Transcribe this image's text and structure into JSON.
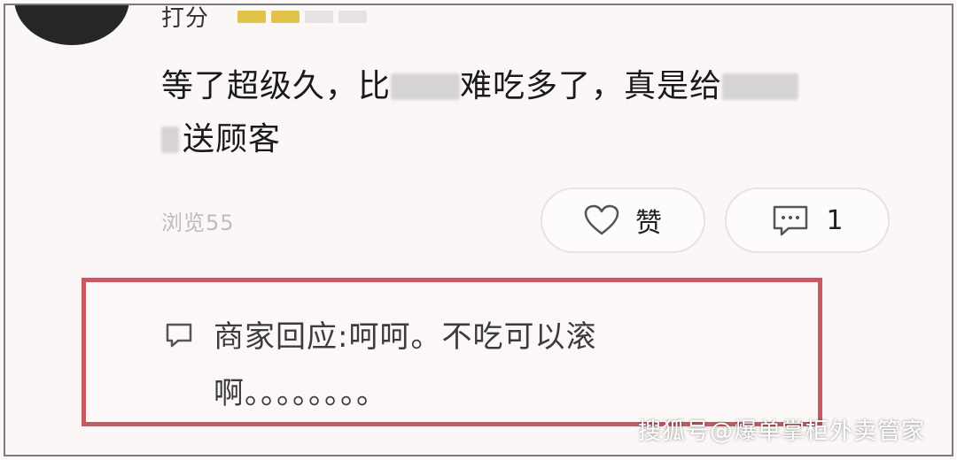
{
  "review": {
    "username": "打分",
    "rating": 2,
    "text_line1_a": "等了超级久，比",
    "text_line1_b": "难吃多了，真是给",
    "text_line2": "送顾客",
    "views": "浏览55"
  },
  "actions": {
    "like_label": "赞",
    "comment_count": "1"
  },
  "merchant_reply": {
    "line1": "商家回应:呵呵。不吃可以滚",
    "line2": "啊。。。。。。。。"
  },
  "watermark": "搜狐号@爆单掌柜外卖管家",
  "colors": {
    "reply_border": "#c45a63",
    "star_on": "#e3c24a",
    "muted_text": "#bdbdbd"
  }
}
